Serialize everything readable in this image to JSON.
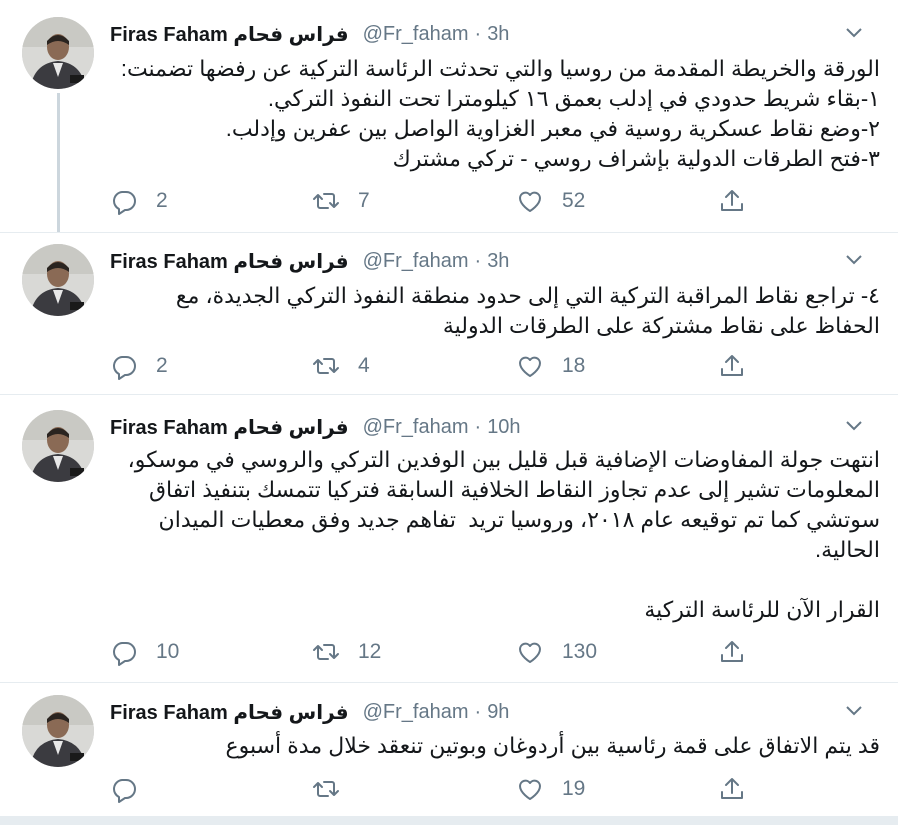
{
  "colors": {
    "text": "#14171a",
    "muted": "#657786",
    "border": "#e6ecf0",
    "thread": "#ccd6dd"
  },
  "tweets": [
    {
      "name": "Firas Faham فراس فحام",
      "handle": "@Fr_faham",
      "time": "3h",
      "text": "الورقة والخريطة المقدمة من روسيا والتي تحدثت الرئاسة التركية عن رفضها تضمنت:\n١-بقاء شريط حدودي في إدلب بعمق ١٦ كيلومترا تحت النفوذ التركي.\n٢-وضع نقاط عسكرية روسية في معبر الغزاوية الواصل بين عفرين وإدلب.\n٣-فتح الطرقات الدولية بإشراف روسي - تركي مشترك",
      "replies": "2",
      "retweets": "7",
      "likes": "52"
    },
    {
      "name": "Firas Faham فراس فحام",
      "handle": "@Fr_faham",
      "time": "3h",
      "text": "٤- تراجع نقاط المراقبة التركية التي إلى حدود منطقة النفوذ التركي الجديدة، مع الحفاظ على نقاط مشتركة على الطرقات الدولية",
      "replies": "2",
      "retweets": "4",
      "likes": "18"
    },
    {
      "name": "Firas Faham فراس فحام",
      "handle": "@Fr_faham",
      "time": "10h",
      "text": "انتهت جولة المفاوضات الإضافية قبل قليل بين الوفدين التركي والروسي في موسكو، المعلومات تشير إلى عدم تجاوز النقاط الخلافية السابقة فتركيا تتمسك بتنفيذ اتفاق سوتشي كما تم توقيعه عام ٢٠١٨، وروسيا تريد  تفاهم جديد وفق معطيات الميدان الحالية.\n\nالقرار الآن للرئاسة التركية",
      "replies": "10",
      "retweets": "12",
      "likes": "130"
    },
    {
      "name": "Firas Faham فراس فحام",
      "handle": "@Fr_faham",
      "time": "9h",
      "text": "قد يتم الاتفاق على قمة رئاسية بين أردوغان وبوتين تنعقد خلال مدة أسبوع",
      "replies": "",
      "retweets": "",
      "likes": "19"
    }
  ]
}
